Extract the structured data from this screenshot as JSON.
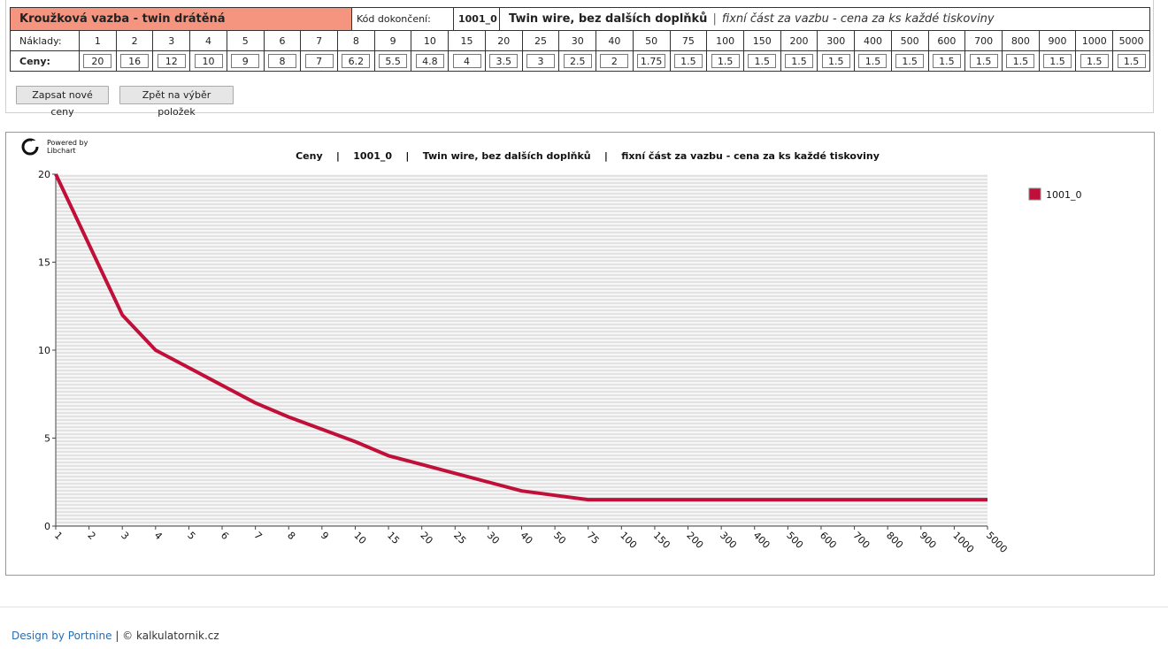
{
  "header": {
    "title": "Kroužková vazba - twin drátěná",
    "kod_label": "Kód dokončení:",
    "kod_value": "1001_0",
    "desc_name": "Twin wire, bez dalších doplňků",
    "desc_sep": "|",
    "desc_note": "fixní část za vazbu - cena za ks každé tiskoviny"
  },
  "table": {
    "naklady_label": "Náklady:",
    "ceny_label": "Ceny:",
    "quantities": [
      "1",
      "2",
      "3",
      "4",
      "5",
      "6",
      "7",
      "8",
      "9",
      "10",
      "15",
      "20",
      "25",
      "30",
      "40",
      "50",
      "75",
      "100",
      "150",
      "200",
      "300",
      "400",
      "500",
      "600",
      "700",
      "800",
      "900",
      "1000",
      "5000"
    ],
    "prices": [
      "20",
      "16",
      "12",
      "10",
      "9",
      "8",
      "7",
      "6.2",
      "5.5",
      "4.8",
      "4",
      "3.5",
      "3",
      "2.5",
      "2",
      "1.75",
      "1.5",
      "1.5",
      "1.5",
      "1.5",
      "1.5",
      "1.5",
      "1.5",
      "1.5",
      "1.5",
      "1.5",
      "1.5",
      "1.5",
      "1.5"
    ]
  },
  "buttons": {
    "save": "Zapsat nové ceny",
    "back": "Zpět na výběr položek"
  },
  "chart_logo": {
    "line1": "Powered by",
    "line2": "Libchart"
  },
  "chart_data": {
    "type": "line",
    "title": "Ceny    |    1001_0    |    Twin wire, bez dalších doplňků    |    fixní část za vazbu - cena za ks každé tiskoviny",
    "categories": [
      "1",
      "2",
      "3",
      "4",
      "5",
      "6",
      "7",
      "8",
      "9",
      "10",
      "15",
      "20",
      "25",
      "30",
      "40",
      "50",
      "75",
      "100",
      "150",
      "200",
      "300",
      "400",
      "500",
      "600",
      "700",
      "800",
      "900",
      "1000",
      "5000"
    ],
    "series": [
      {
        "name": "1001_0",
        "values": [
          20,
          16,
          12,
          10,
          9,
          8,
          7,
          6.2,
          5.5,
          4.8,
          4,
          3.5,
          3,
          2.5,
          2,
          1.75,
          1.5,
          1.5,
          1.5,
          1.5,
          1.5,
          1.5,
          1.5,
          1.5,
          1.5,
          1.5,
          1.5,
          1.5,
          1.5
        ]
      }
    ],
    "y_ticks": [
      "0",
      "5",
      "10",
      "15",
      "20"
    ],
    "ylim": [
      0,
      20
    ],
    "grid": true,
    "legend": "right",
    "color": "#c0103a"
  },
  "footer": {
    "design_link": "Design by Portnine",
    "separator": " | ",
    "copyright": "© kalkulatornik.cz"
  }
}
